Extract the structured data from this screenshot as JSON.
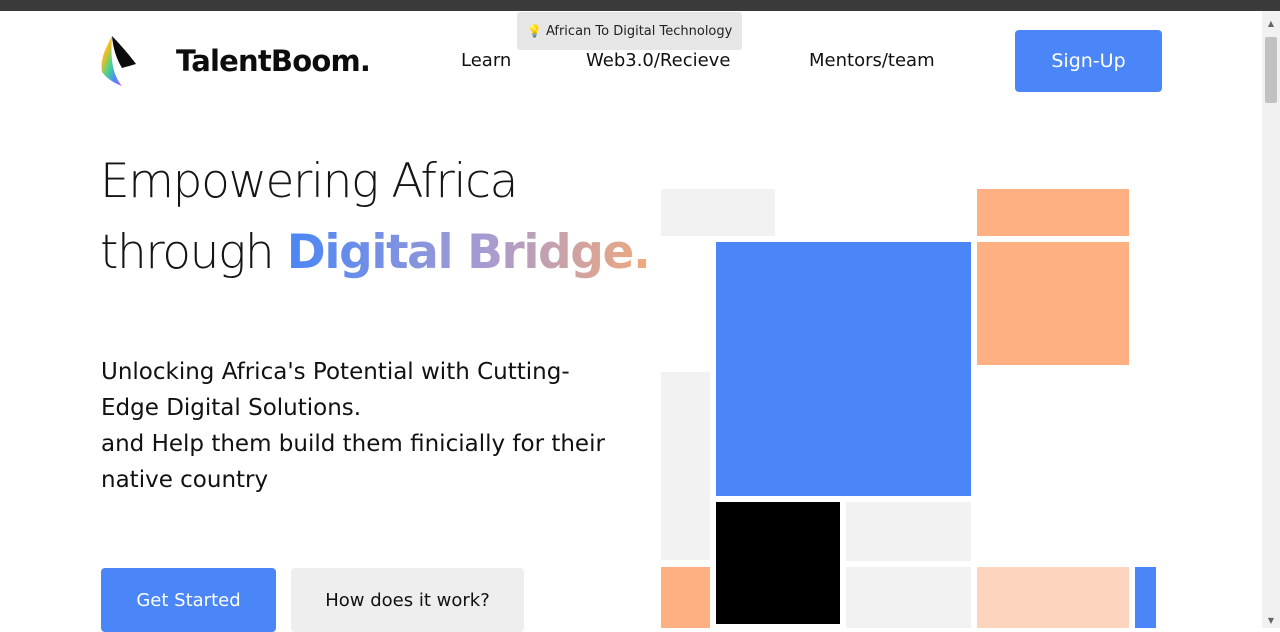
{
  "tooltip": {
    "icon": "lightbulb-icon",
    "text": "African To Digital Technology"
  },
  "header": {
    "brand": "TalentBoom.",
    "logo_icon": "rainbow-quill-icon",
    "nav": [
      {
        "label": "Learn"
      },
      {
        "label": "Web3.0/Recieve"
      },
      {
        "label": "Mentors/team"
      }
    ],
    "signup_label": "Sign-Up"
  },
  "hero": {
    "title_line1": "Empowering Africa",
    "title_line2_plain": "through ",
    "title_line2_highlight": "Digital Bridge.",
    "subtitle_line1": "Unlocking Africa's Potential with Cutting-Edge Digital Solutions.",
    "subtitle_line2": "and Help them build them finicially for their native country",
    "cta_primary": "Get Started",
    "cta_secondary": "How does it work?"
  },
  "colors": {
    "accent_blue": "#4a86f7",
    "peach": "#ffb083",
    "light_peach": "#fdd5bf",
    "tile_gray": "#f2f2f2",
    "black": "#000000"
  }
}
